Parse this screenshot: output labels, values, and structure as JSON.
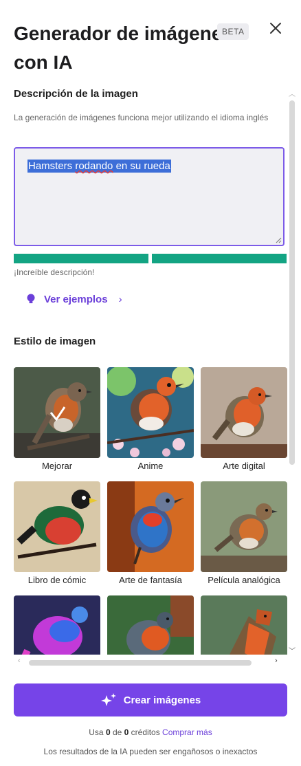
{
  "header": {
    "title_line1": "Generador de imágenes",
    "title_line2": "con IA",
    "badge": "BETA"
  },
  "prompt": {
    "label": "Descripción de la imagen",
    "hint": "La generación de imágenes funciona mejor utilizando el idioma inglés",
    "value_before": "Hamsters ",
    "value_misspelled": "rodando",
    "value_after": " en su rueda",
    "quality_text": "¡Increíble descripción!",
    "quality_bar_color": "#13a483"
  },
  "examples": {
    "label": "Ver ejemplos",
    "chevron": "›"
  },
  "styles": {
    "label": "Estilo de imagen",
    "items": [
      {
        "label": "Mejorar",
        "selected": true
      },
      {
        "label": "Anime",
        "selected": false
      },
      {
        "label": "Arte digital",
        "selected": false
      },
      {
        "label": "Libro de cómic",
        "selected": false
      },
      {
        "label": "Arte de fantasía",
        "selected": false
      },
      {
        "label": "Película analógica",
        "selected": false
      },
      {
        "label": "",
        "selected": false
      },
      {
        "label": "",
        "selected": false
      },
      {
        "label": "",
        "selected": false
      }
    ]
  },
  "action": {
    "create_label": "Crear imágenes",
    "accent_color": "#7644e8"
  },
  "credits": {
    "prefix": "Usa ",
    "used": "0",
    "middle": " de ",
    "total": "0",
    "suffix": " créditos ",
    "buy_link": "Comprar más"
  },
  "disclaimer": "Los resultados de la IA pueden ser engañosos o inexactos"
}
